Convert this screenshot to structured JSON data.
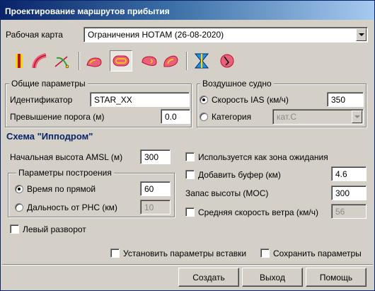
{
  "window": {
    "title": "Проектирование маршрутов прибытия"
  },
  "work_map": {
    "label": "Рабочая карта",
    "selected": "Ограничения НОТАМ (26-08-2020)"
  },
  "toolbar": {
    "icons": [
      "vertical-line-icon",
      "curved-arrival-icon",
      "dme-arc-icon",
      "holding-left-icon",
      "holding-oval-icon",
      "holding-turn-icon",
      "holding-reverse-icon",
      "hourglass-icon",
      "waypoint-icon"
    ],
    "colors": {
      "yellow": "#ffd700",
      "pink": "#e8607a",
      "red": "#c01030",
      "blue": "#2090e0",
      "green": "#30a030"
    }
  },
  "general": {
    "title": "Общие параметры",
    "identifier_label": "Идентификатор",
    "identifier_value": "STAR_XX",
    "threshold_label": "Превышение порога (м)",
    "threshold_value": "0.0"
  },
  "aircraft": {
    "title": "Воздушное судно",
    "speed_label": "Скорость IAS (км/ч)",
    "speed_value": "350",
    "speed_selected": true,
    "category_label": "Категория",
    "category_value": "кат.C"
  },
  "scheme": {
    "title": "Схема \"Ипподром\"",
    "start_alt_label": "Начальная высота AMSL (м)",
    "start_alt_value": "300",
    "holding_label": "Используется как зона ожидания",
    "buffer_label": "Добавить буфер (км)",
    "buffer_value": "4.6",
    "moc_label": "Запас высоты (МОС)",
    "moc_value": "300",
    "wind_label": "Средняя скорость ветра (км/ч)",
    "wind_value": "56",
    "build": {
      "title": "Параметры построения",
      "time_label": "Время по прямой",
      "time_value": "60",
      "time_selected": true,
      "dist_label": "Дальность от РНС  (км)",
      "dist_value": "10"
    },
    "left_turn_label": "Левый разворот"
  },
  "options": {
    "insert_params_label": "Установить параметры вставки",
    "save_params_label": "Сохранить параметры"
  },
  "buttons": {
    "create": "Создать",
    "exit": "Выход",
    "help": "Помощь"
  }
}
